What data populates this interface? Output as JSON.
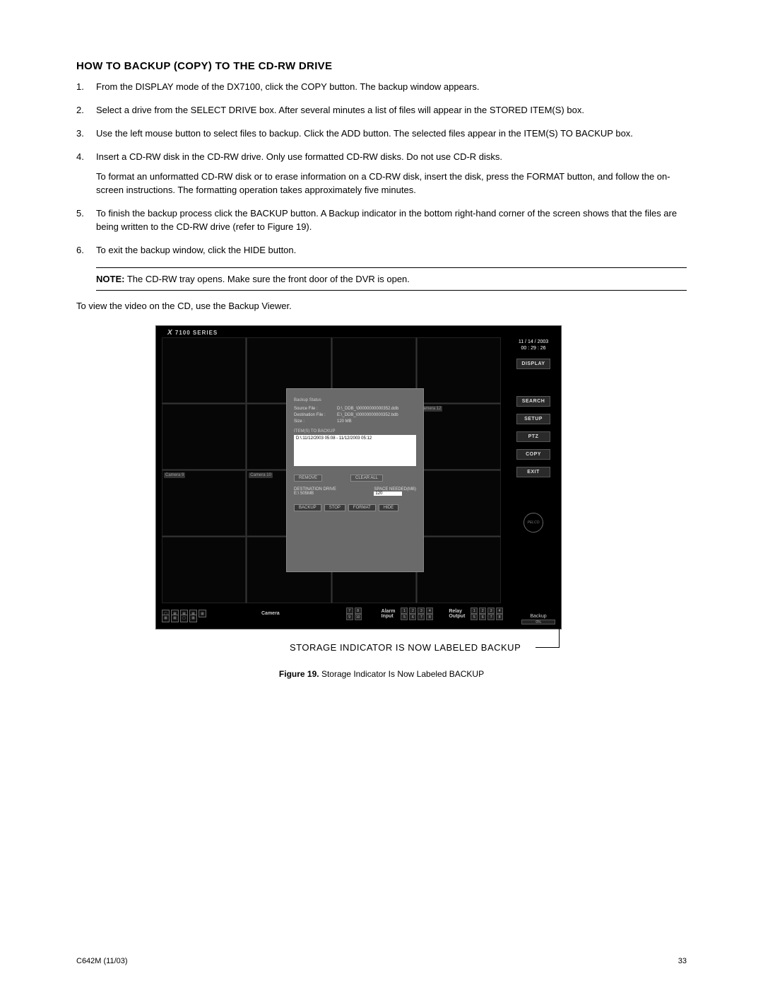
{
  "heading": "HOW TO BACKUP (COPY) TO THE CD-RW DRIVE",
  "steps": [
    {
      "text": "From the DISPLAY mode of the DX7100, click the COPY button. The backup window appears."
    },
    {
      "text": "Select a drive from the SELECT DRIVE box. After several minutes a list of files will appear in the STORED ITEM(S) box."
    },
    {
      "text": "Use the left mouse button to select files to backup. Click the ADD button. The selected files appear in the ITEM(S) TO BACKUP box."
    },
    {
      "text": "Insert a CD-RW disk in the CD-RW drive. Only use formatted CD-RW disks. Do not use CD-R disks.",
      "extra": "To format an unformatted CD-RW disk or to erase information on a CD-RW disk, insert the disk, press the FORMAT button, and follow the on-screen instructions. The formatting operation takes approximately five minutes."
    },
    {
      "text": "To finish the backup process click the BACKUP button. A Backup indicator in the bottom right-hand corner of the screen shows that the files are being written to the CD-RW drive (refer to Figure 19)."
    },
    {
      "text": "To exit the backup window, click the HIDE button."
    }
  ],
  "note_label": "NOTE:",
  "note_text": "The CD-RW tray opens. Make sure the front door of the DVR is open.",
  "post_note": "To view the video on the CD, use the Backup Viewer.",
  "dvr": {
    "series": "7100 SERIES",
    "date": "11 / 14 / 2003",
    "time": "00 : 29 : 26",
    "side_buttons": [
      "DISPLAY",
      "SEARCH",
      "SETUP",
      "PTZ",
      "COPY",
      "EXIT"
    ],
    "logo": "PELCO",
    "dialog": {
      "status_label": "Backup Status",
      "source_k": "Source File :",
      "source_v": "D:\\_DDB_\\00000000000352.ddb",
      "dest_k": "Destination File :",
      "dest_v": "E:\\_DDB_\\00000000000352.bdb",
      "size_k": "Size :",
      "size_v": "120 MB",
      "items_label": "ITEM(S) TO BACKUP",
      "items_line": "D:\\:11/12/2003 05:08 - 11/12/2003 05:12",
      "btn_remove": "REMOVE",
      "btn_clear": "CLEAR ALL",
      "dest_drive_k": "DESTINATION DRIVE",
      "dest_drive_v": "E:\\ 505MB",
      "space_k": "SPACE NEEDED(MB)",
      "space_v": "120",
      "btn_backup": "BACKUP",
      "btn_stop": "STOP",
      "btn_format": "FORMAT",
      "btn_hide": "HIDE"
    },
    "cams": {
      "c1": "Camera 9",
      "c2": "Camera 10",
      "c3": "Camera 12"
    },
    "bottom": {
      "camera": "Camera",
      "camera_nums_a": [
        "7",
        "8"
      ],
      "camera_nums_b": [
        "9",
        "10"
      ],
      "alarm": "Alarm\nInput",
      "alarm_nums": [
        "1",
        "2",
        "3",
        "4",
        "5",
        "6",
        "7",
        "8"
      ],
      "relay": "Relay\nOutput",
      "relay_nums": [
        "1",
        "2",
        "3",
        "4",
        "5",
        "6",
        "7",
        "8"
      ],
      "backup_label": "Backup",
      "backup_pct": "0%"
    }
  },
  "callout": "STORAGE INDICATOR IS NOW LABELED BACKUP",
  "figure_label": "Figure 19.",
  "figure_caption": "Storage Indicator Is Now Labeled BACKUP",
  "footer_left": "C642M (11/03)",
  "footer_right": "33"
}
